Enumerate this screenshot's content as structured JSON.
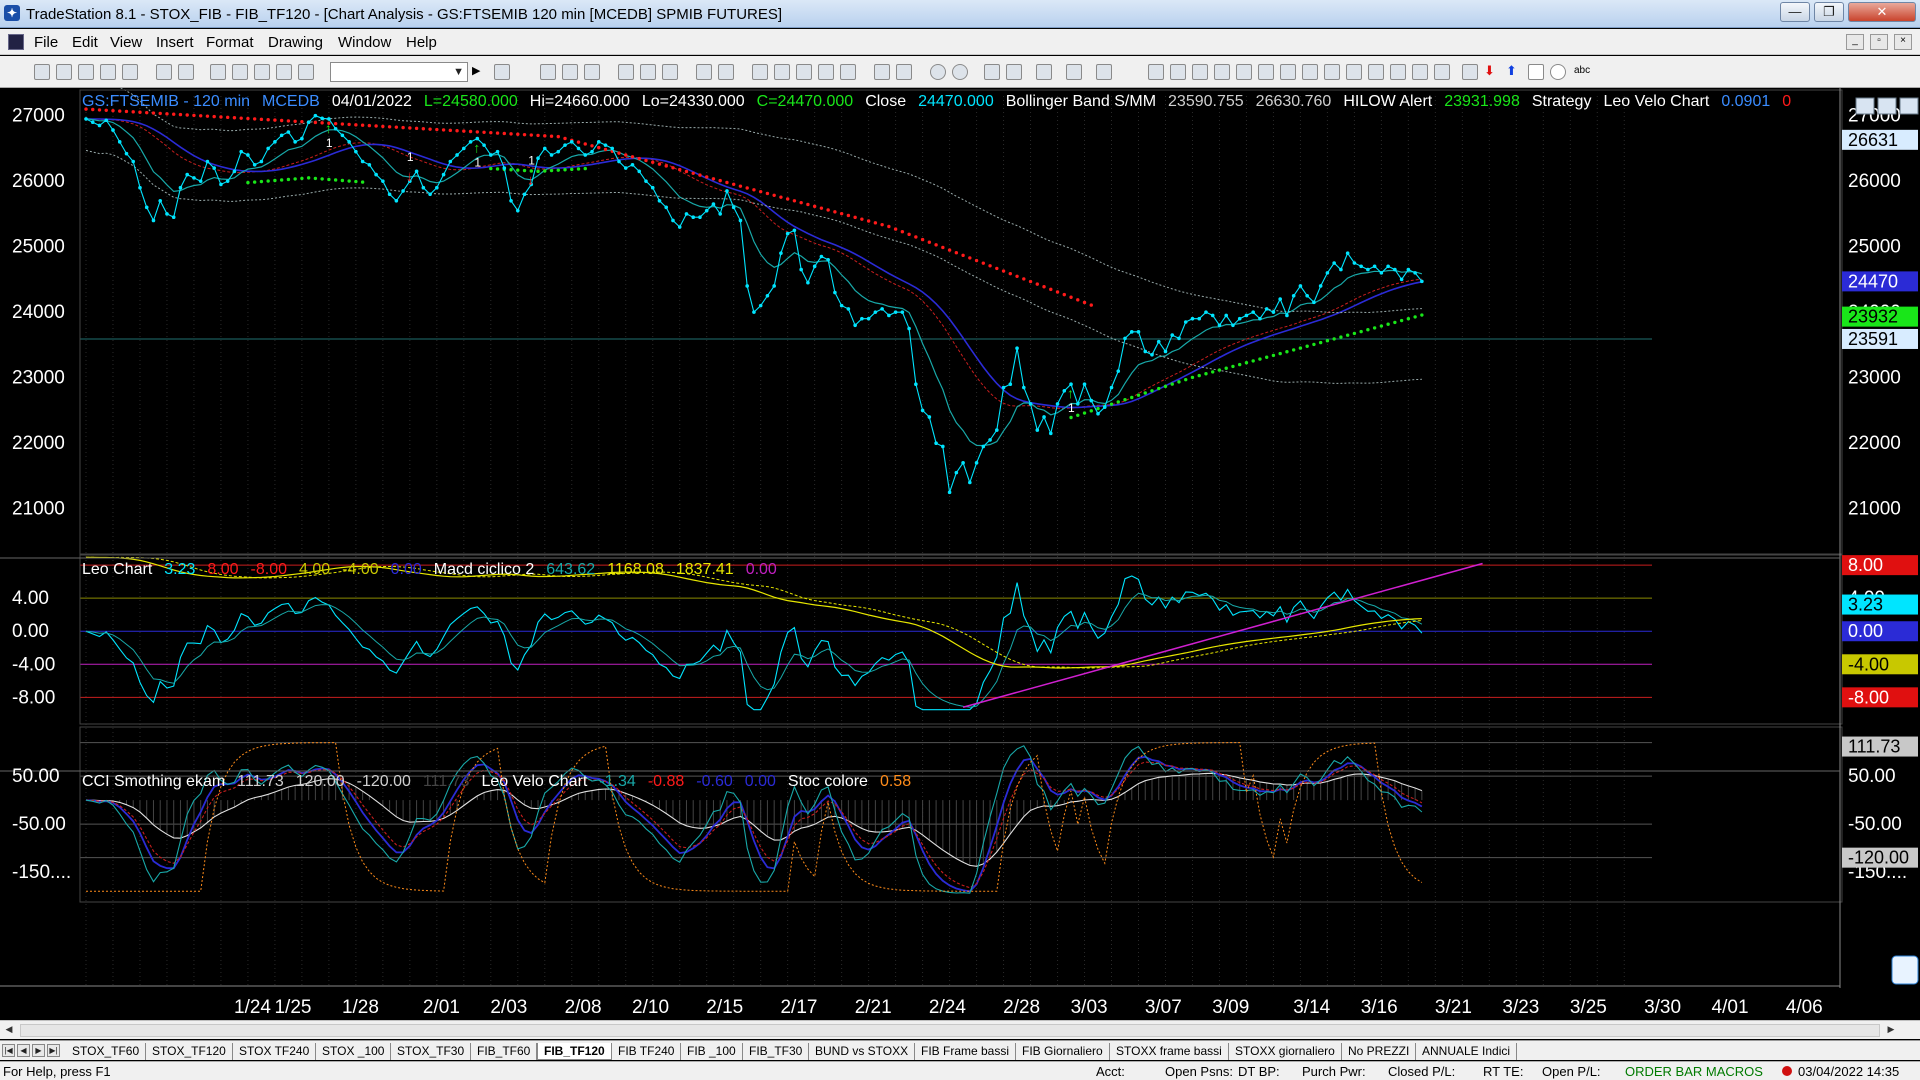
{
  "window": {
    "title": "TradeStation 8.1 - STOX_FIB - FIB_TF120 - [Chart Analysis - GS:FTSEMIB  120 min  [MCEDB] SPMIB FUTURES]",
    "minimize": "—",
    "restore": "❐",
    "close": "✕"
  },
  "menu": [
    "File",
    "Edit",
    "View",
    "Insert",
    "Format",
    "Drawing",
    "Window",
    "Help"
  ],
  "colors": {
    "price": "#00e5ff",
    "bb_upper": "#2b2bd6",
    "bb_mid": "#c81e1e",
    "bb_lower": "#18a8a8",
    "hilow_red": "#ff1a1a",
    "hilow_green": "#19e619",
    "velo": "#00e5ff"
  },
  "price_header": [
    {
      "text": "GS:FTSEMIB - 120 min",
      "color": "#3a8cff"
    },
    {
      "text": "MCEDB",
      "color": "#3a8cff"
    },
    {
      "text": "04/01/2022",
      "color": "#ffffff"
    },
    {
      "text": "L=24580.000",
      "color": "#19e619"
    },
    {
      "text": "Hi=24660.000",
      "color": "#ffffff"
    },
    {
      "text": "Lo=24330.000",
      "color": "#ffffff"
    },
    {
      "text": "C=24470.000",
      "color": "#19e619"
    },
    {
      "text": "Close",
      "color": "#ffffff"
    },
    {
      "text": "24470.000",
      "color": "#00e5ff"
    },
    {
      "text": "Bollinger Band S/MM",
      "color": "#ffffff"
    },
    {
      "text": "23590.755",
      "color": "#cfcfcf"
    },
    {
      "text": "26630.760",
      "color": "#cfcfcf"
    },
    {
      "text": "HILOW Alert",
      "color": "#ffffff"
    },
    {
      "text": "23931.998",
      "color": "#19e619"
    },
    {
      "text": "Strategy",
      "color": "#ffffff"
    },
    {
      "text": "Leo Velo Chart",
      "color": "#ffffff"
    },
    {
      "text": "0.0901",
      "color": "#3a8cff"
    },
    {
      "text": "0",
      "color": "#ff1a1a"
    }
  ],
  "leo_header": [
    {
      "text": "Leo Chart",
      "color": "#ffffff"
    },
    {
      "text": "3.23",
      "color": "#00e5ff"
    },
    {
      "text": "8.00",
      "color": "#ff1a1a"
    },
    {
      "text": "-8.00",
      "color": "#ff1a1a"
    },
    {
      "text": "4.00",
      "color": "#c8c800"
    },
    {
      "text": "-4.00",
      "color": "#c8c800"
    },
    {
      "text": "0.00",
      "color": "#2b2bd6"
    },
    {
      "text": "Macd ciclico 2",
      "color": "#ffffff"
    },
    {
      "text": "643.62",
      "color": "#18a8a8"
    },
    {
      "text": "1168.08",
      "color": "#e6e600"
    },
    {
      "text": "1837.41",
      "color": "#e6e600"
    },
    {
      "text": "0.00",
      "color": "#c020c0"
    }
  ],
  "cci_header": [
    {
      "text": "CCI Smothing ekam",
      "color": "#ffffff"
    },
    {
      "text": "111.73",
      "color": "#cfcfcf"
    },
    {
      "text": "120.00",
      "color": "#cfcfcf"
    },
    {
      "text": "-120.00",
      "color": "#cfcfcf"
    },
    {
      "text": "111.73",
      "color": "#444444"
    },
    {
      "text": "Leo Velo Chart",
      "color": "#ffffff"
    },
    {
      "text": "-1.34",
      "color": "#18a8a8"
    },
    {
      "text": "-0.88",
      "color": "#ff1a1a"
    },
    {
      "text": "-0.60",
      "color": "#2b2bd6"
    },
    {
      "text": "0.00",
      "color": "#2b2bd6"
    },
    {
      "text": "Stoc colore",
      "color": "#ffffff"
    },
    {
      "text": "0.58",
      "color": "#ff8c1a"
    }
  ],
  "price_axis": {
    "ticks": [
      "27000",
      "26000",
      "25000",
      "24000",
      "23000",
      "22000",
      "21000"
    ],
    "vals": [
      27000,
      26000,
      25000,
      24000,
      23000,
      22000,
      21000
    ],
    "min": 20400,
    "max": 27300
  },
  "price_markers": [
    {
      "text": "26631",
      "val": 26631,
      "bg": "#d8ecff",
      "fg": "#000"
    },
    {
      "text": "24470",
      "val": 24470,
      "bg": "#2b2bd6",
      "fg": "#fff"
    },
    {
      "text": "23932",
      "val": 23932,
      "bg": "#19e619",
      "fg": "#000"
    },
    {
      "text": "23591",
      "val": 23591,
      "bg": "#d8ecff",
      "fg": "#000"
    }
  ],
  "leo_axis": {
    "ticks": [
      "4.00",
      "0.00",
      "-4.00",
      "-8.00"
    ],
    "vals": [
      4,
      0,
      -4,
      -8
    ],
    "min": -10.5,
    "max": 8.5
  },
  "leo_markers": [
    {
      "text": "8.00",
      "val": 8,
      "bg": "#e01010",
      "fg": "#fff"
    },
    {
      "text": "3.23",
      "val": 3.23,
      "bg": "#00e5ff",
      "fg": "#000"
    },
    {
      "text": "0.00",
      "val": 0,
      "bg": "#2b2bd6",
      "fg": "#fff"
    },
    {
      "text": "-4.00",
      "val": -4,
      "bg": "#c8c800",
      "fg": "#000"
    },
    {
      "text": "-8.00",
      "val": -8,
      "bg": "#e01010",
      "fg": "#fff"
    }
  ],
  "cci_axis": {
    "ticks": [
      "50.00",
      "-50.00",
      "-150...."
    ],
    "vals": [
      50,
      -50,
      -150
    ],
    "min": -200,
    "max": 140
  },
  "cci_markers": [
    {
      "text": "111.73",
      "val": 111.73,
      "bg": "#c8c8c8",
      "fg": "#000"
    },
    {
      "text": "-120.00",
      "val": -120,
      "bg": "#c8c8c8",
      "fg": "#000"
    }
  ],
  "dates": [
    "1/24",
    "1/25",
    "1/28",
    "2/01",
    "2/03",
    "2/08",
    "2/10",
    "2/15",
    "2/17",
    "2/21",
    "2/24",
    "2/28",
    "3/03",
    "3/07",
    "3/09",
    "3/14",
    "3/16",
    "3/21",
    "3/23",
    "3/25",
    "3/30",
    "4/01",
    "4/06"
  ],
  "signals": [
    {
      "label": "1",
      "type": "buy",
      "bar": 36
    },
    {
      "label": "1",
      "type": "sell",
      "bar": 48
    },
    {
      "label": "1",
      "type": "buy",
      "bar": 58
    },
    {
      "label": "1",
      "type": "sell",
      "bar": 66
    },
    {
      "label": "1",
      "type": "buy",
      "bar": 146
    }
  ],
  "tabs": [
    "STOX_TF60",
    "STOX_TF120",
    "STOX TF240",
    "STOX _100",
    "STOX_TF30",
    "FIB_TF60",
    "FIB_TF120",
    "FIB TF240",
    "FIB _100",
    "FIB_TF30",
    "BUND vs STOXX",
    "FIB Frame bassi",
    "FIB Giornaliero",
    "STOXX frame bassi",
    "STOXX giornaliero",
    "No PREZZI",
    "ANNUALE Indici"
  ],
  "active_tab": "FIB_TF120",
  "status": {
    "help": "For Help, press F1",
    "acct": "Acct:",
    "open_psns": "Open Psns:",
    "dt_bp": "DT BP:",
    "purch_pwr": "Purch Pwr:",
    "closed_pl": "Closed P/L:",
    "rt_te": "RT TE:",
    "open_pl": "Open P/L:",
    "macros": "ORDER BAR  MACROS",
    "datetime": "03/04/2022 14:35"
  },
  "chart_data": {
    "type": "line",
    "symbol": "GS:FTSEMIB",
    "interval": "120 min",
    "last": {
      "open": 24580,
      "high": 24660,
      "low": 24330,
      "close": 24470
    },
    "bollinger": {
      "lower": 23590.755,
      "upper": 26630.76
    },
    "hilow_alert": 23931.998,
    "price_close": [
      26950,
      26900,
      26850,
      26930,
      26780,
      26600,
      26420,
      26300,
      25900,
      25600,
      25400,
      25700,
      25500,
      25450,
      25900,
      26100,
      26050,
      26000,
      26300,
      26200,
      25950,
      26000,
      26150,
      26450,
      26400,
      26250,
      26300,
      26500,
      26600,
      26700,
      26750,
      26600,
      26650,
      26900,
      27000,
      26960,
      26950,
      26800,
      26700,
      26600,
      26450,
      26300,
      26250,
      26100,
      26000,
      25800,
      25700,
      25850,
      26000,
      26150,
      25900,
      25800,
      25900,
      26100,
      26300,
      26400,
      26500,
      26600,
      26650,
      26550,
      26400,
      26450,
      26200,
      25700,
      25550,
      25800,
      25950,
      26350,
      26500,
      26400,
      26450,
      26550,
      26600,
      26500,
      26400,
      26450,
      26600,
      26550,
      26500,
      26300,
      26200,
      26250,
      26150,
      26000,
      25900,
      25700,
      25600,
      25400,
      25300,
      25500,
      25450,
      25450,
      25550,
      25650,
      25500,
      25850,
      25600,
      25400,
      24400,
      24000,
      24100,
      24250,
      24400,
      24900,
      25200,
      25250,
      24650,
      24450,
      24700,
      24850,
      24800,
      24300,
      24100,
      24050,
      23800,
      23900,
      23900,
      24000,
      24050,
      23950,
      24000,
      24000,
      23750,
      22900,
      22500,
      22400,
      22000,
      21950,
      21250,
      21550,
      21700,
      21400,
      21700,
      21950,
      22050,
      22200,
      22850,
      22900,
      23450,
      22850,
      22600,
      22200,
      22400,
      22150,
      22600,
      22800,
      22900,
      22600,
      22900,
      22650,
      22450,
      22550,
      22850,
      23100,
      23600,
      23700,
      23700,
      23400,
      23350,
      23550,
      23400,
      23650,
      23600,
      23850,
      23900,
      23900,
      24000,
      23950,
      23800,
      23950,
      23800,
      23900,
      23950,
      24000,
      23900,
      24050,
      24000,
      24200,
      23950,
      24250,
      24400,
      24250,
      24150,
      24400,
      24600,
      24750,
      24650,
      24900,
      24750,
      24700,
      24650,
      24700,
      24600,
      24700,
      24650,
      24500,
      24650,
      24600,
      24470
    ],
    "indicators": [
      "Bollinger Band S/MM",
      "HILOW Alert",
      "Leo Velo Chart",
      "Leo Chart",
      "Macd ciclico 2",
      "CCI Smothing ekam",
      "Stoc colore"
    ],
    "panels": [
      {
        "name": "price",
        "ylim": [
          20400,
          27300
        ]
      },
      {
        "name": "Leo Chart",
        "ylim": [
          -10.5,
          8.5
        ],
        "levels": [
          8,
          4,
          0,
          -4,
          -8
        ]
      },
      {
        "name": "CCI Smothing ekam",
        "ylim": [
          -200,
          140
        ],
        "levels": [
          120,
          50,
          -50,
          -120
        ]
      }
    ]
  }
}
